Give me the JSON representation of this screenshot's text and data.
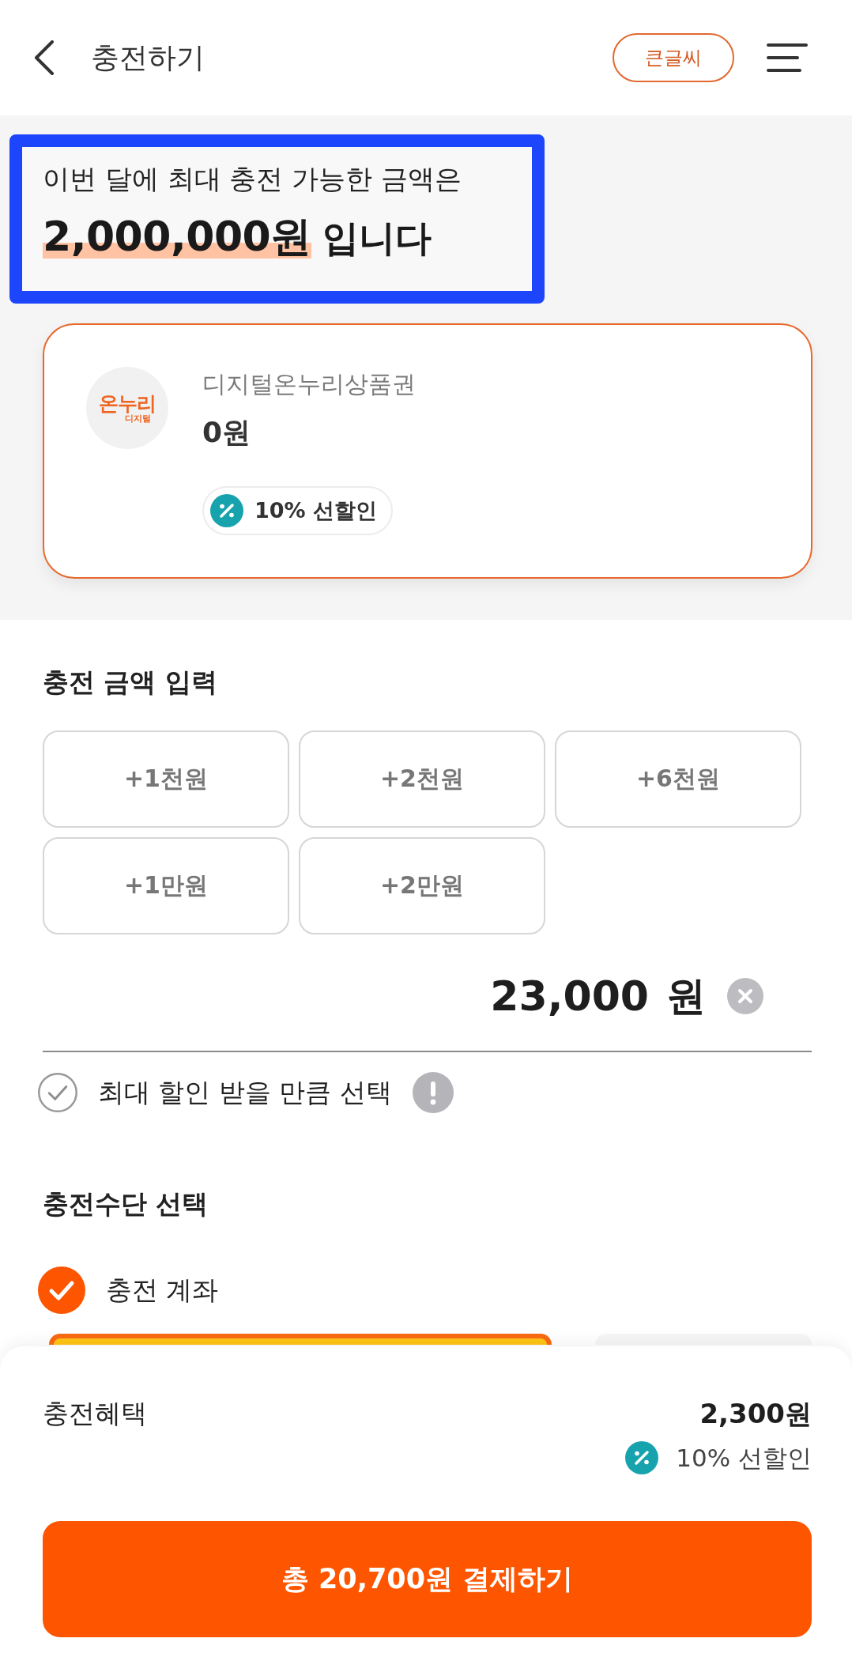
{
  "header": {
    "title": "충전하기",
    "large_text_button": "큰글씨"
  },
  "limit_notice": {
    "highlighted": true,
    "line": "이번 달에 최대 충전 가능한 금액은",
    "amount": "2,000,000원",
    "suffix": "입니다"
  },
  "voucher_card": {
    "selected": true,
    "logo": {
      "text": "온누리",
      "subtext": "디지털"
    },
    "name": "디지털온누리상품권",
    "balance": "0원",
    "badge": "10% 선할인"
  },
  "amount_input": {
    "title": "충전 금액 입력",
    "quick_buttons": [
      "+1천원",
      "+2천원",
      "+6천원",
      "+1만원",
      "+2만원"
    ],
    "value": "23,000",
    "unit": "원",
    "max_discount": {
      "label": "최대 할인 받을 만큼 선택",
      "checked": false
    }
  },
  "payment_method": {
    "title": "충전수단 선택",
    "options": [
      {
        "label": "충전 계좌",
        "selected": true
      }
    ]
  },
  "summary": {
    "label": "충전혜택",
    "amount": "2,300원",
    "benefit": "10% 선할인"
  },
  "pay_button": "총 20,700원 결제하기"
}
